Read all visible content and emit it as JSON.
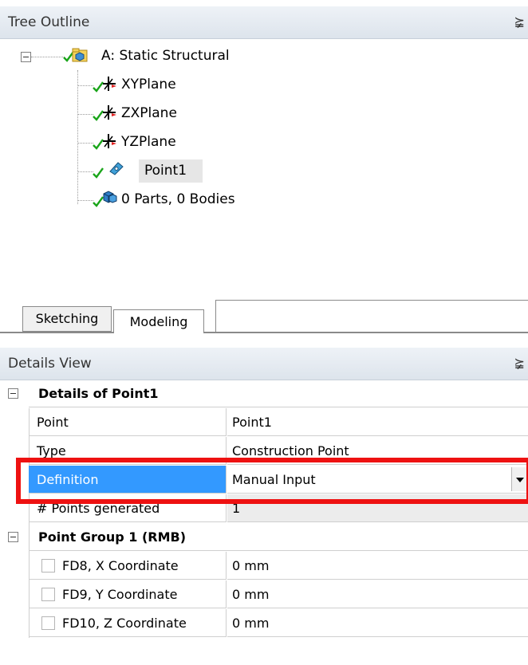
{
  "tree_outline": {
    "title": "Tree Outline",
    "pin_glyph": "⪶",
    "root": {
      "label": "A: Static Structural",
      "icon": "geometry-root-icon"
    },
    "children": [
      {
        "label": "XYPlane",
        "icon": "plane-axis-icon"
      },
      {
        "label": "ZXPlane",
        "icon": "plane-axis-icon"
      },
      {
        "label": "YZPlane",
        "icon": "plane-axis-icon"
      },
      {
        "label": "Point1",
        "icon": "point-feature-icon",
        "selected": true
      },
      {
        "label": "0 Parts, 0 Bodies",
        "icon": "parts-bodies-icon"
      }
    ]
  },
  "tabs": {
    "sketching": "Sketching",
    "modeling": "Modeling"
  },
  "details_view": {
    "title": "Details View",
    "pin_glyph": "⪶",
    "group1": {
      "header": "Details of Point1",
      "rows": [
        {
          "label": "Point",
          "value": "Point1"
        },
        {
          "label": "Type",
          "value": "Construction Point"
        },
        {
          "label": "Definition",
          "value": "Manual Input"
        },
        {
          "label": "# Points generated",
          "value": "1"
        }
      ]
    },
    "group2": {
      "header": "Point Group 1  (RMB)",
      "rows": [
        {
          "label": "FD8, X Coordinate",
          "value": "0 mm"
        },
        {
          "label": "FD9, Y Coordinate",
          "value": "0 mm"
        },
        {
          "label": "FD10, Z Coordinate",
          "value": "0 mm"
        }
      ]
    }
  },
  "colors": {
    "highlight": "#3399ff",
    "annotation_red": "#ee1111",
    "check_green": "#1aa51a"
  }
}
